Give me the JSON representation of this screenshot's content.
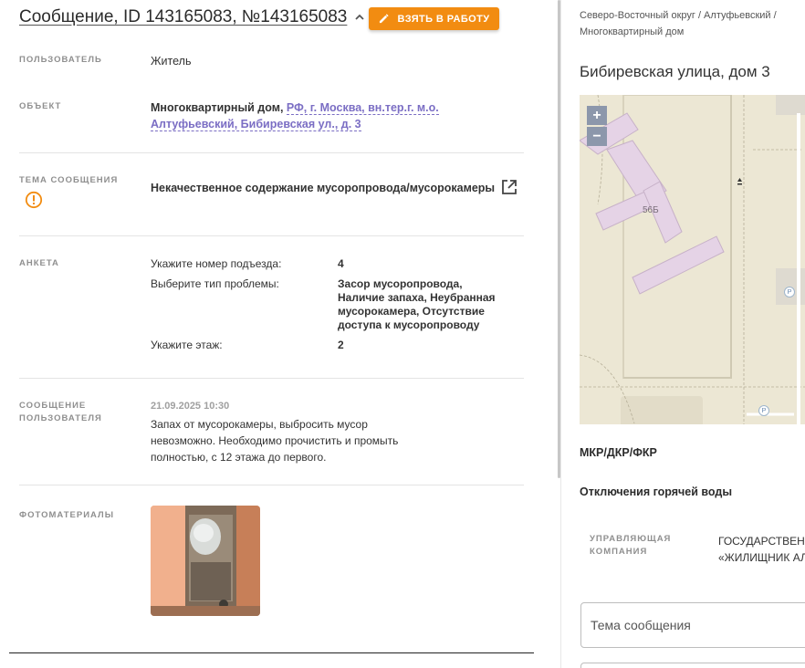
{
  "header": {
    "title": "Сообщение, ID 143165083, №143165083",
    "take_button": "ВЗЯТЬ В РАБОТУ"
  },
  "fields": {
    "user_label": "ПОЛЬЗОВАТЕЛЬ",
    "user_value": "Житель",
    "object_label": "ОБЪЕКТ",
    "object_type": "Многоквартирный дом,",
    "object_address": "РФ, г. Москва, вн.тер.г. м.о. Алтуфьевский, Бибиревская ул., д. 3",
    "topic_label": "ТЕМА СООБЩЕНИЯ",
    "topic_value": "Некачественное содержание мусоропровода/мусорокамеры",
    "survey_label": "АНКЕТА",
    "survey": [
      {
        "q": "Укажите номер подъезда:",
        "a": "4"
      },
      {
        "q": "Выберите тип проблемы:",
        "a": "Засор мусоропровода, Наличие запаха, Неубранная мусорокамера, Отсутствие доступа к мусоропроводу"
      },
      {
        "q": "Укажите этаж:",
        "a": "2"
      }
    ],
    "message_label": "СООБЩЕНИЕ ПОЛЬЗОВАТЕЛЯ",
    "message_date": "21.09.2025 10:30",
    "message_text": "Запах от мусорокамеры, выбросить мусор невозможно. Необходимо прочистить и промыть полностью, с 12 этажа до первого.",
    "photos_label": "ФОТОМАТЕРИАЛЫ"
  },
  "right": {
    "breadcrumbs": "Северо-Восточный округ / Алтуфьевский / Многоквартирный дом",
    "address_title": "Бибиревская улица, дом 3",
    "map": {
      "zoom_in": "+",
      "zoom_out": "−",
      "building_label": "56Б",
      "parking_1": "P",
      "parking_2": "P"
    },
    "mkr_title": "МКР/ДКР/ФКР",
    "hot_water_title": "Отключения горячей воды",
    "uk_label_1": "УПРАВЛЯЮЩАЯ",
    "uk_label_2": "КОМПАНИЯ",
    "uk_value_1": "ГОСУДАРСТВЕННОЕ",
    "uk_value_2": "«ЖИЛИЩНИК АЛТУФЬЕВСКИЙ»",
    "topic_input_placeholder": "Тема сообщения"
  },
  "colors": {
    "accent": "#f28c11",
    "link": "#7b6ec4",
    "warning": "#f28c11",
    "building": "#e5d3e6"
  }
}
